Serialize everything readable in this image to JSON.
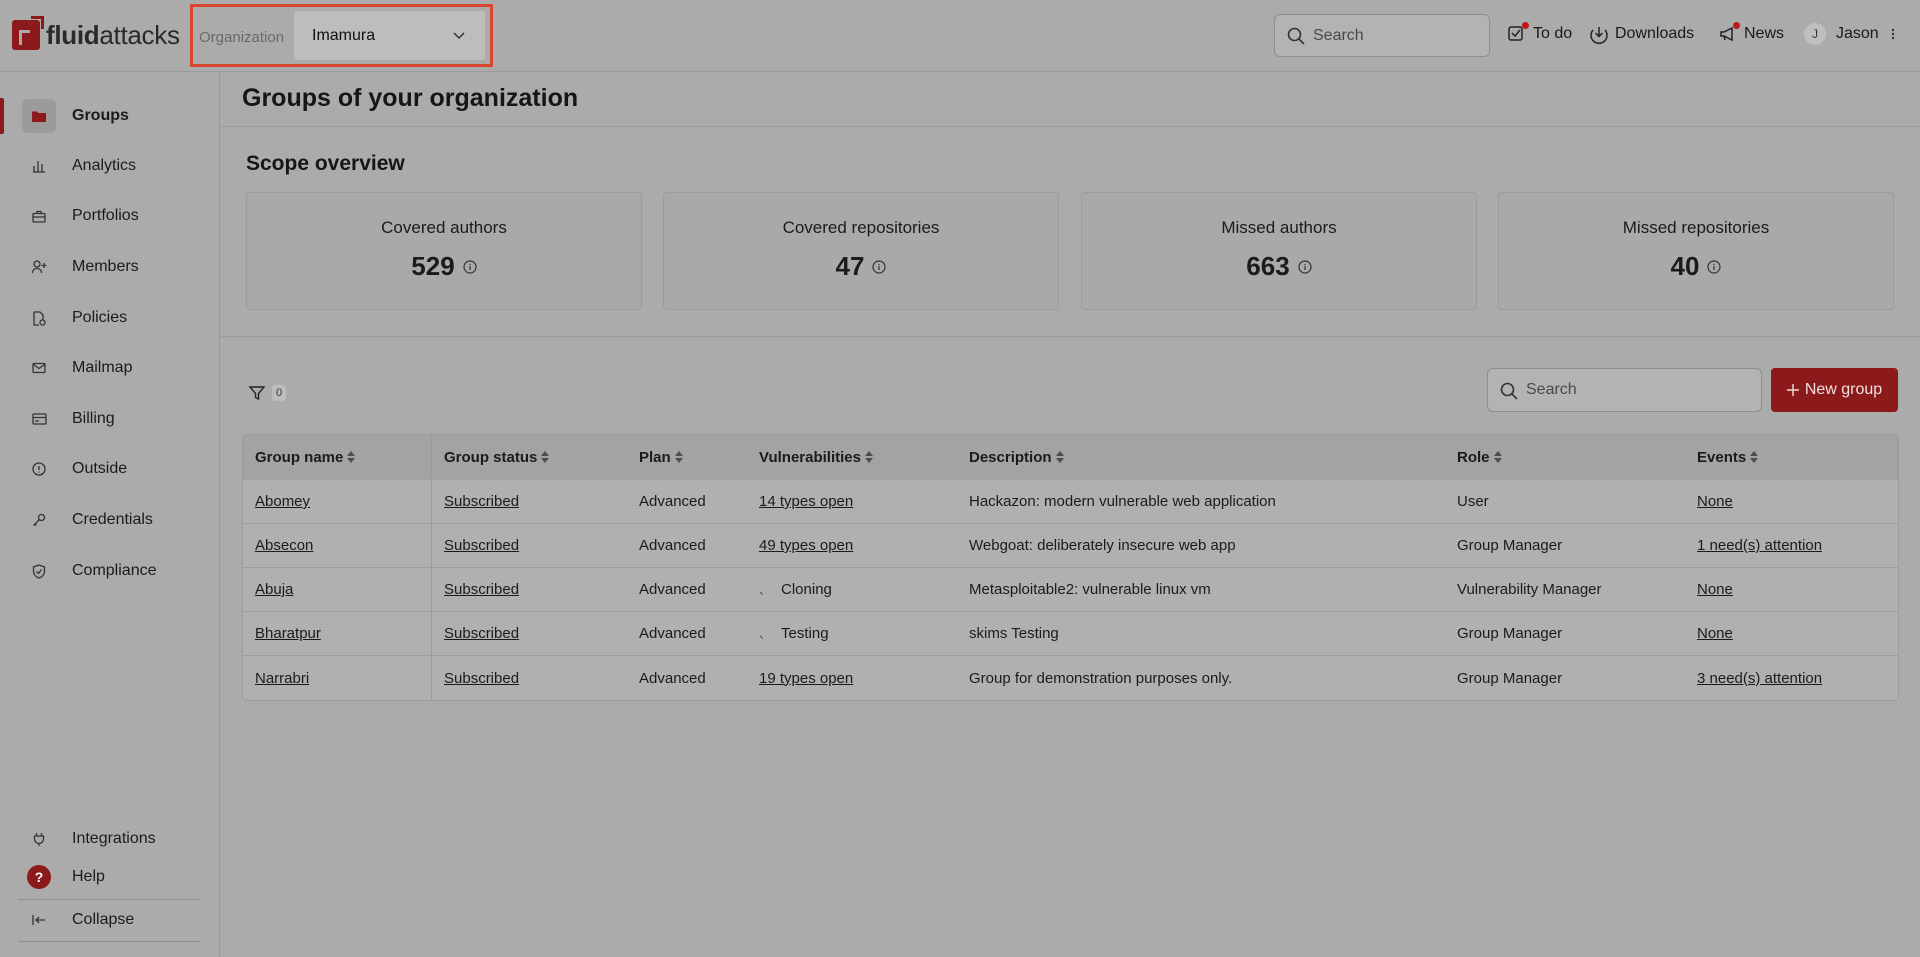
{
  "brand": {
    "logo_bold": "fluid",
    "logo_light": "attacks"
  },
  "organization": {
    "label": "Organization",
    "value": "Imamura"
  },
  "topbar": {
    "search_placeholder": "Search",
    "todo_label": "To do",
    "downloads_label": "Downloads",
    "news_label": "News",
    "user_initial": "J",
    "user_name": "Jason"
  },
  "sidebar": {
    "items": [
      {
        "label": "Groups",
        "icon": "folder-icon",
        "active": true
      },
      {
        "label": "Analytics",
        "icon": "bar-chart-icon"
      },
      {
        "label": "Portfolios",
        "icon": "briefcase-icon"
      },
      {
        "label": "Members",
        "icon": "user-plus-icon"
      },
      {
        "label": "Policies",
        "icon": "policy-icon"
      },
      {
        "label": "Mailmap",
        "icon": "mail-icon"
      },
      {
        "label": "Billing",
        "icon": "credit-card-icon"
      },
      {
        "label": "Outside",
        "icon": "info-circle-icon"
      },
      {
        "label": "Credentials",
        "icon": "key-icon"
      },
      {
        "label": "Compliance",
        "icon": "shield-check-icon"
      }
    ],
    "integrations_label": "Integrations",
    "help_label": "Help",
    "help_glyph": "?",
    "collapse_label": "Collapse"
  },
  "main": {
    "title": "Groups of your organization",
    "scope_title": "Scope overview",
    "cards": [
      {
        "label": "Covered authors",
        "value": "529"
      },
      {
        "label": "Covered repositories",
        "value": "47"
      },
      {
        "label": "Missed authors",
        "value": "663"
      },
      {
        "label": "Missed repositories",
        "value": "40"
      }
    ],
    "filter_count": "0",
    "table_search_placeholder": "Search",
    "new_group_label": "New group"
  },
  "table": {
    "columns": [
      "Group name",
      "Group status",
      "Plan",
      "Vulnerabilities",
      "Description",
      "Role",
      "Events"
    ],
    "rows": [
      {
        "name": "Abomey",
        "status": "Subscribed",
        "plan": "Advanced",
        "vulns": "14 types open",
        "vulns_link": true,
        "description": "Hackazon: modern vulnerable web application",
        "role": "User",
        "events": "None"
      },
      {
        "name": "Absecon",
        "status": "Subscribed",
        "plan": "Advanced",
        "vulns": "49 types open",
        "vulns_link": true,
        "description": "Webgoat: deliberately insecure web app",
        "role": "Group Manager",
        "events": "1 need(s) attention"
      },
      {
        "name": "Abuja",
        "status": "Subscribed",
        "plan": "Advanced",
        "vulns": "Cloning",
        "vulns_link": false,
        "description": "Metasploitable2: vulnerable linux vm",
        "role": "Vulnerability Manager",
        "events": "None"
      },
      {
        "name": "Bharatpur",
        "status": "Subscribed",
        "plan": "Advanced",
        "vulns": "Testing",
        "vulns_link": false,
        "description": "skims Testing",
        "role": "Group Manager",
        "events": "None"
      },
      {
        "name": "Narrabri",
        "status": "Subscribed",
        "plan": "Advanced",
        "vulns": "19 types open",
        "vulns_link": true,
        "description": "Group for demonstration purposes only.",
        "role": "Group Manager",
        "events": "3 need(s) attention"
      }
    ]
  }
}
